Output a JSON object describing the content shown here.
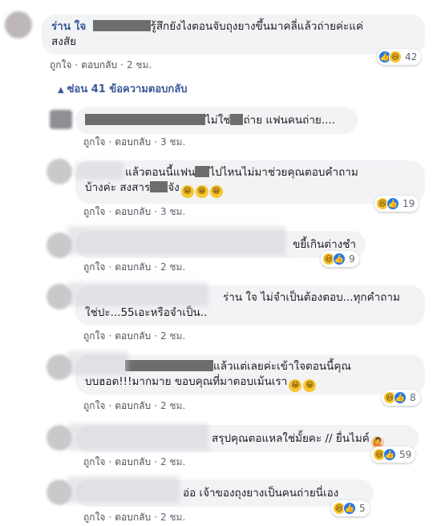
{
  "actions": {
    "like": "ถูกใจ",
    "reply": "ตอบกลับ",
    "dot": "·"
  },
  "hide_replies": "ซ่อน 41 ข้อความตอบกลับ",
  "top_comment": {
    "name": "ร่าน ใจ",
    "text_a": "รู้สึกยังไงตอนจับถุงยางขึ้นมาคลี่แล้วถ่ายค่ะแค่",
    "text_b": "สงสัย",
    "time": "2 ชม.",
    "reactions": {
      "icons": [
        "like-icon",
        "haha-icon"
      ],
      "count": "42"
    }
  },
  "replies": [
    {
      "text_a": "ไม่ใช่",
      "text_b": "ถ่าย แฟนคนถ่าย....",
      "time": "3 ชม.",
      "count": ""
    },
    {
      "text_a": "แล้วตอนนี้แฟน",
      "text_b": "ไปไหนไม่มาช่วยคุณตอบคำถาม",
      "text_c": "บ้างค่ะ สงสาร",
      "text_d": "จัง",
      "time": "3 ชม.",
      "count": "19"
    },
    {
      "text_a": "ขยี้เกินต่างชำ",
      "time": "2 ชม.",
      "count": "9"
    },
    {
      "text_a": "ร่าน ใจ ไม่จำเป็นต้องตอบ...ทุกคำถาม",
      "text_b": "ใช่ปะ...55เอะหรือจำเป็น..",
      "time": "2 ชม.",
      "count": ""
    },
    {
      "text_a": "แล้วแต่เลยค่ะเข้าใจตอนนี้คุณ",
      "text_b": "บบฮอต!!!มากมาย ขอบคุณที่มาตอบเม้นเรา",
      "time": "2 ชม.",
      "count": "8"
    },
    {
      "text_a": "สรุปคุณตอแหลใช่มั้ยคะ // ยื่นไมค์",
      "time": "2 ชม.",
      "count": "59"
    },
    {
      "text_a": "อ่อ เจ้าของถุงยางเป็นคนถ่ายนี่เอง",
      "time": "2 ชม.",
      "count": "5"
    }
  ],
  "colors": {
    "link": "#385898",
    "bubble": "#f2f3f5",
    "like": "#2078f4",
    "haha": "#f7c631"
  }
}
